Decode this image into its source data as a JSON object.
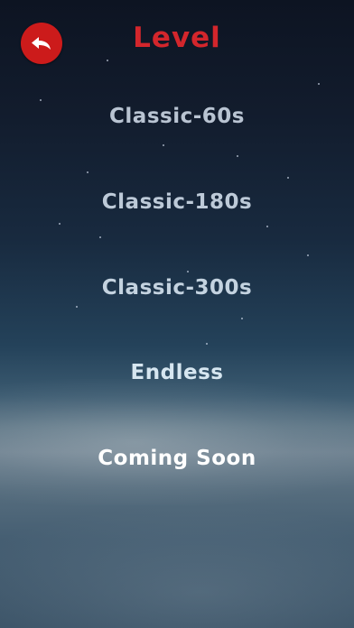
{
  "header": {
    "title": "Level",
    "back_icon": "back-arrow-icon"
  },
  "levels": [
    {
      "label": "Classic-60s"
    },
    {
      "label": "Classic-180s"
    },
    {
      "label": "Classic-300s"
    },
    {
      "label": "Endless"
    },
    {
      "label": "Coming Soon"
    }
  ],
  "colors": {
    "accent": "#cc1b1b",
    "title": "#d3262c"
  }
}
